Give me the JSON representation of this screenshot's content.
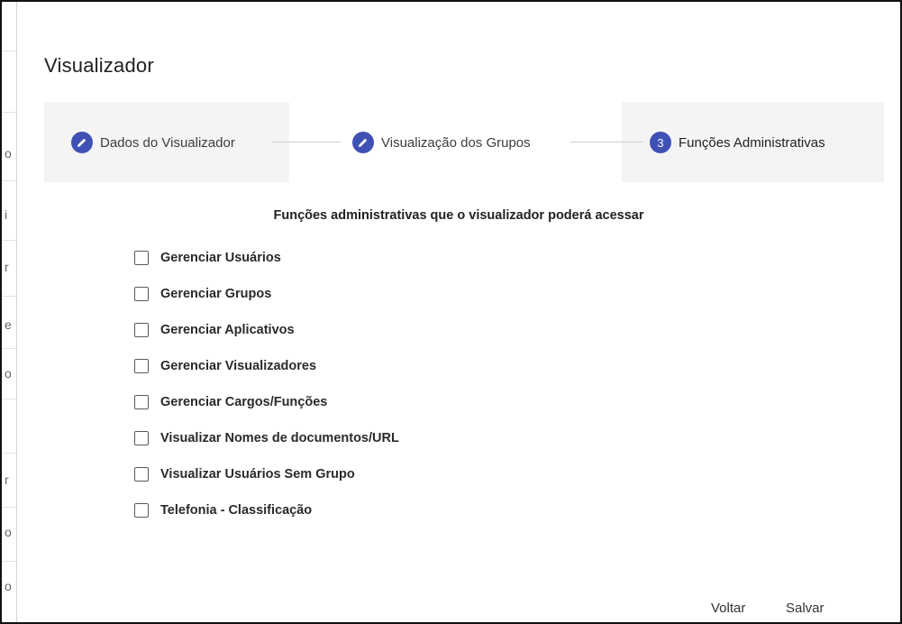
{
  "background": {
    "visible_fragments": [
      "o",
      "i",
      "r",
      "e",
      "o",
      "r",
      "o",
      "o"
    ]
  },
  "dialog": {
    "title": "Visualizador",
    "stepper": {
      "accent_color": "#3f51b5",
      "steps": [
        {
          "label": "Dados do Visualizador",
          "state": "completed",
          "icon": "pencil-icon"
        },
        {
          "label": "Visualização dos Grupos",
          "state": "completed",
          "icon": "pencil-icon"
        },
        {
          "label": "Funções Administrativas",
          "state": "active",
          "number": "3"
        }
      ]
    },
    "subtitle": "Funções administrativas que o visualizador poderá acessar",
    "options": [
      {
        "label": "Gerenciar Usuários",
        "checked": false
      },
      {
        "label": "Gerenciar Grupos",
        "checked": false
      },
      {
        "label": "Gerenciar Aplicativos",
        "checked": false
      },
      {
        "label": "Gerenciar Visualizadores",
        "checked": false
      },
      {
        "label": "Gerenciar Cargos/Funções",
        "checked": false
      },
      {
        "label": "Visualizar Nomes de documentos/URL",
        "checked": false
      },
      {
        "label": "Visualizar Usuários Sem Grupo",
        "checked": false
      },
      {
        "label": "Telefonia - Classificação",
        "checked": false
      }
    ],
    "actions": {
      "back_label": "Voltar",
      "save_label": "Salvar"
    }
  }
}
